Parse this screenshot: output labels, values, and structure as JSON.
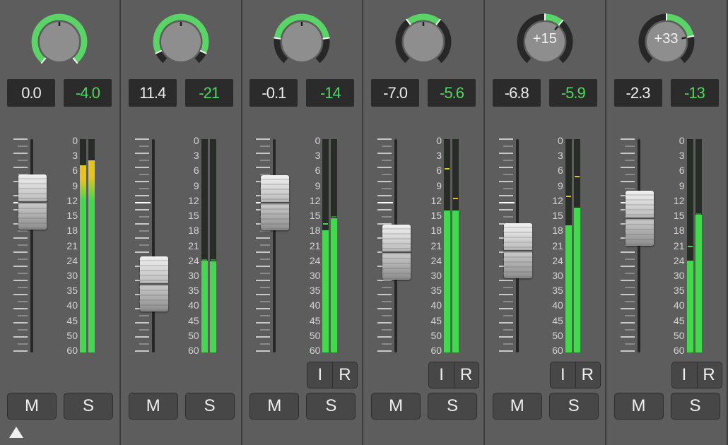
{
  "colors": {
    "background": "#5d5d5d",
    "knob_arc": "#5ad466",
    "meter_green": "#44d84f",
    "meter_yellow": "#e8c419",
    "readout_bg": "#2b2b2b",
    "peak_text": "#4fd860"
  },
  "meter_scale": [
    "0",
    "3",
    "6",
    "9",
    "12",
    "15",
    "18",
    "21",
    "24",
    "30",
    "35",
    "40",
    "45",
    "50",
    "60"
  ],
  "buttons": {
    "mute": "M",
    "solo": "S",
    "input": "I",
    "record": "R"
  },
  "channels": [
    {
      "pan_label": "",
      "pan_value": 0,
      "volume": "0.0",
      "peak": "-4.0",
      "fader_db": 0,
      "meter_levels_db": [
        5,
        4
      ],
      "meter_peaks_db": [
        5,
        4
      ],
      "has_input_record": false
    },
    {
      "pan_label": "",
      "pan_value": -0.1,
      "volume": "11.4",
      "peak": "-21",
      "fader_db": -11.4,
      "meter_levels_db": [
        24,
        24.5
      ],
      "meter_peaks_db": [
        23.8,
        23.8
      ],
      "has_input_record": false
    },
    {
      "pan_label": "",
      "pan_value": -0.35,
      "volume": "-0.1",
      "peak": "-14",
      "fader_db": -0.1,
      "meter_levels_db": [
        18,
        15.5
      ],
      "meter_peaks_db": [
        16.5,
        15.2
      ],
      "has_input_record": true
    },
    {
      "pan_label": "",
      "pan_value": -0.6,
      "volume": "-7.0",
      "peak": "-5.6",
      "fader_db": -7,
      "meter_levels_db": [
        14,
        14
      ],
      "meter_peaks_db": [
        5.5,
        11.5
      ],
      "has_input_record": true
    },
    {
      "pan_label": "+15",
      "pan_value": 15,
      "volume": "-6.8",
      "peak": "-5.9",
      "fader_db": -6.8,
      "meter_levels_db": [
        17,
        13.5
      ],
      "meter_peaks_db": [
        11,
        7
      ],
      "has_input_record": true
    },
    {
      "pan_label": "+33",
      "pan_value": 33,
      "volume": "-2.3",
      "peak": "-13",
      "fader_db": -2.3,
      "meter_levels_db": [
        24,
        14.8
      ],
      "meter_peaks_db": [
        21,
        14.5
      ],
      "has_input_record": true
    }
  ]
}
